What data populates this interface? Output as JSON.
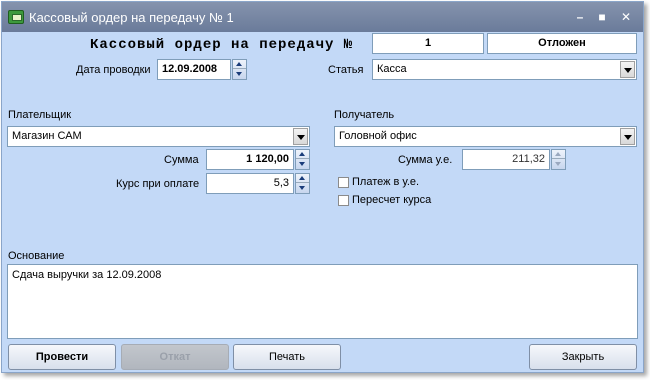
{
  "window": {
    "title": "Кассовый ордер на передачу № 1"
  },
  "form": {
    "heading": "Кассовый ордер на передачу №",
    "number": "1",
    "status": "Отложен",
    "date_label": "Дата проводки",
    "date_value": "12.09.2008",
    "article_label": "Статья",
    "article_value": "Касса",
    "payer_label": "Плательщик",
    "payer_value": "Магазин САМ",
    "recipient_label": "Получатель",
    "recipient_value": "Головной офис",
    "sum_label": "Сумма",
    "sum_value": "1 120,00",
    "rate_label": "Курс при оплате",
    "rate_value": "5,3",
    "sum_ue_label": "Сумма у.е.",
    "sum_ue_value": "211,32",
    "payment_ue_label": "Платеж в у.е.",
    "payment_ue_checked": false,
    "recalc_label": "Пересчет курса",
    "recalc_checked": false,
    "basis_label": "Основание",
    "basis_value": "Сдача выручки за 12.09.2008"
  },
  "buttons": {
    "post": "Провести",
    "rollback": "Откат",
    "print": "Печать",
    "close": "Закрыть"
  }
}
